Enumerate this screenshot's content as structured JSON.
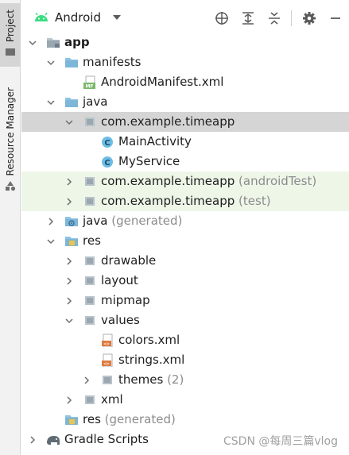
{
  "side_strip": {
    "project_tab": "Project",
    "resource_manager_tab": "Resource Manager"
  },
  "toolbar": {
    "view_name": "Android"
  },
  "tree": {
    "app": "app",
    "manifests": "manifests",
    "android_manifest": "AndroidManifest.xml",
    "manifest_badge": "MF",
    "java": "java",
    "pkg_main": "com.example.timeapp",
    "main_activity": "MainActivity",
    "my_service": "MyService",
    "class_badge": "C",
    "pkg_android_test": "com.example.timeapp",
    "android_test_suffix": "(androidTest)",
    "pkg_test": "com.example.timeapp",
    "test_suffix": "(test)",
    "java_generated": "java",
    "java_generated_suffix": "(generated)",
    "res": "res",
    "drawable": "drawable",
    "layout": "layout",
    "mipmap": "mipmap",
    "values": "values",
    "colors": "colors.xml",
    "strings": "strings.xml",
    "themes": "themes",
    "themes_count": "(2)",
    "xml": "xml",
    "res_generated": "res",
    "res_generated_suffix": "(generated)",
    "gradle_scripts": "Gradle Scripts"
  },
  "watermark": "CSDN @每周三篇vlog",
  "colors": {
    "selection": "#d5d5d5",
    "test_highlight": "#eef6e8",
    "folder_blue": "#7eb6d9",
    "package_gray": "#9aa7b0",
    "class_circle": "#3e9bd6",
    "android_green": "#3ddc84",
    "muted_text": "#8c8c8c"
  }
}
